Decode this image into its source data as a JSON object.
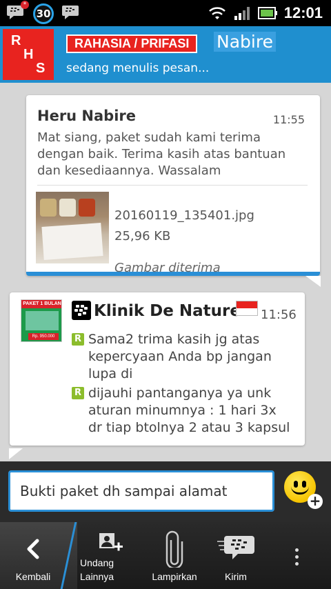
{
  "status_bar": {
    "notification_count": "30",
    "notification_star": "*",
    "time": "12:01"
  },
  "header": {
    "avatar_letters": [
      "R",
      "H",
      "S"
    ],
    "group_name": "RAHASIA / PRIFASI",
    "contact_name": "Nabire",
    "typing_status": "sedang menulis pesan..."
  },
  "messages": [
    {
      "sender": "Heru Nabire",
      "time": "11:55",
      "text": "Mat siang, paket sudah kami terima dengan baik. Terima kasih atas bantuan dan kesediaannya. Wassalam",
      "attachment": {
        "file_name": "20160119_135401.jpg",
        "file_size": "25,96 KB",
        "status": "Gambar diterima"
      }
    },
    {
      "sender": "Klinik De Nature",
      "time": "11:56",
      "promo_lines": [
        "PAKET 1 BULAN",
        "Rp. 950.000"
      ],
      "items": [
        {
          "icon": "R",
          "text": "Sama2 trima kasih jg atas kepercyaan Anda bp jangan lupa di"
        },
        {
          "icon": "R",
          "text": "dijauhi pantanganya ya unk aturan minumnya : 1 hari 3x dr tiap btolnya 2 atau 3 kapsul"
        }
      ]
    }
  ],
  "composer": {
    "value": "Bukti paket dh sampai alamat",
    "add_symbol": "+"
  },
  "toolbar": {
    "back_label": "Kembali",
    "invite_label_1": "Undang",
    "invite_label_2": "Lainnya",
    "attach_label": "Lampirkan",
    "send_label": "Kirim"
  },
  "colors": {
    "accent_blue": "#1f8fcf",
    "brand_red": "#e8231f",
    "read_green": "#8cbd2c"
  },
  "icons": [
    "bbm-icon",
    "wifi-icon",
    "signal-icon",
    "battery-icon",
    "blackberry-logo-icon",
    "indonesia-flag-icon",
    "smiley-icon",
    "back-icon",
    "invite-icon",
    "paperclip-icon",
    "bbm-send-icon",
    "more-icon"
  ]
}
